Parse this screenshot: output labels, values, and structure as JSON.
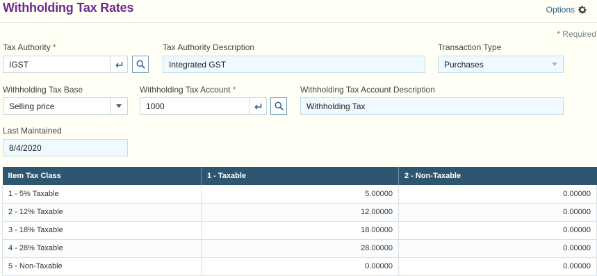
{
  "header": {
    "title": "Withholding Tax Rates",
    "options_label": "Options"
  },
  "required_note": {
    "star": "*",
    "text": " Required"
  },
  "form": {
    "tax_authority": {
      "label": "Tax Authority",
      "required_star": "*",
      "value": "IGST"
    },
    "tax_authority_description": {
      "label": "Tax Authority Description",
      "value": "Integrated GST"
    },
    "transaction_type": {
      "label": "Transaction Type",
      "value": "Purchases"
    },
    "withholding_tax_base": {
      "label": "Withholding Tax Base",
      "value": "Selling price"
    },
    "withholding_tax_account": {
      "label": "Withholding Tax Account",
      "required_star": "*",
      "value": "1000"
    },
    "withholding_tax_account_description": {
      "label": "Withholding Tax Account Description",
      "value": "Withholding Tax"
    },
    "last_maintained": {
      "label": "Last Maintained",
      "value": "8/4/2020"
    }
  },
  "grid": {
    "columns": [
      "Item Tax Class",
      "1 - Taxable",
      "2 - Non-Taxable"
    ],
    "rows": [
      [
        "1 - 5% Taxable",
        "5.00000",
        "0.00000"
      ],
      [
        "2 - 12% Taxable",
        "12.00000",
        "0.00000"
      ],
      [
        "3 - 18% Taxable",
        "18.00000",
        "0.00000"
      ],
      [
        "4 - 28% Taxable",
        "28.00000",
        "0.00000"
      ],
      [
        "5 - Non-Taxable",
        "0.00000",
        "0.00000"
      ]
    ]
  },
  "colors": {
    "title": "#6b2a8e",
    "grid_header": "#2e5670",
    "required_star": "#36a640",
    "readonly_field": "#eefaff"
  },
  "icons": [
    "gear-icon",
    "enter-icon",
    "search-icon",
    "chevron-down-icon"
  ]
}
